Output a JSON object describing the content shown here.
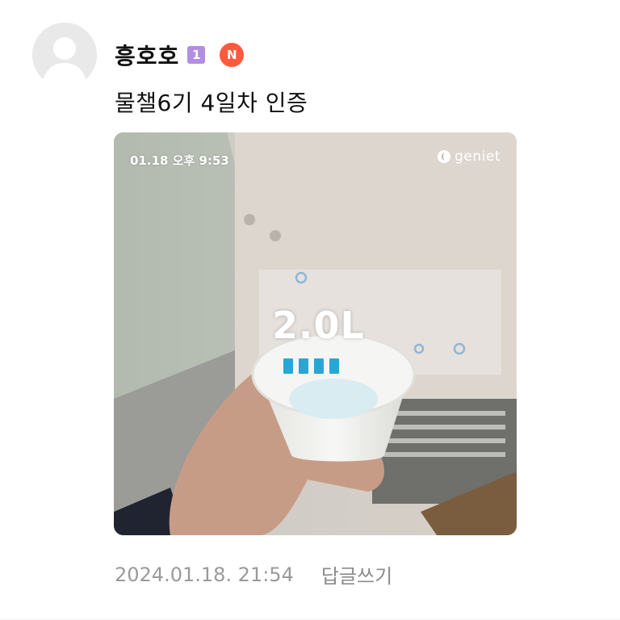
{
  "comment": {
    "nickname": "흥호호",
    "level_badge": "1",
    "new_badge": "N",
    "text": "물챌6기 4일차 인증",
    "timestamp": "2024.01.18. 21:54",
    "reply_label": "답글쓰기"
  },
  "photo": {
    "overlay_time": "01.18 오후 9:53",
    "brand": "geniet",
    "amount": "2.0L",
    "level_bars": [
      1,
      1,
      1,
      1
    ]
  },
  "colors": {
    "level_badge": "#b38ee0",
    "new_badge": "#ff5a3c",
    "level_bar": "#29a6d6",
    "meta_text": "#9a9a9a"
  }
}
